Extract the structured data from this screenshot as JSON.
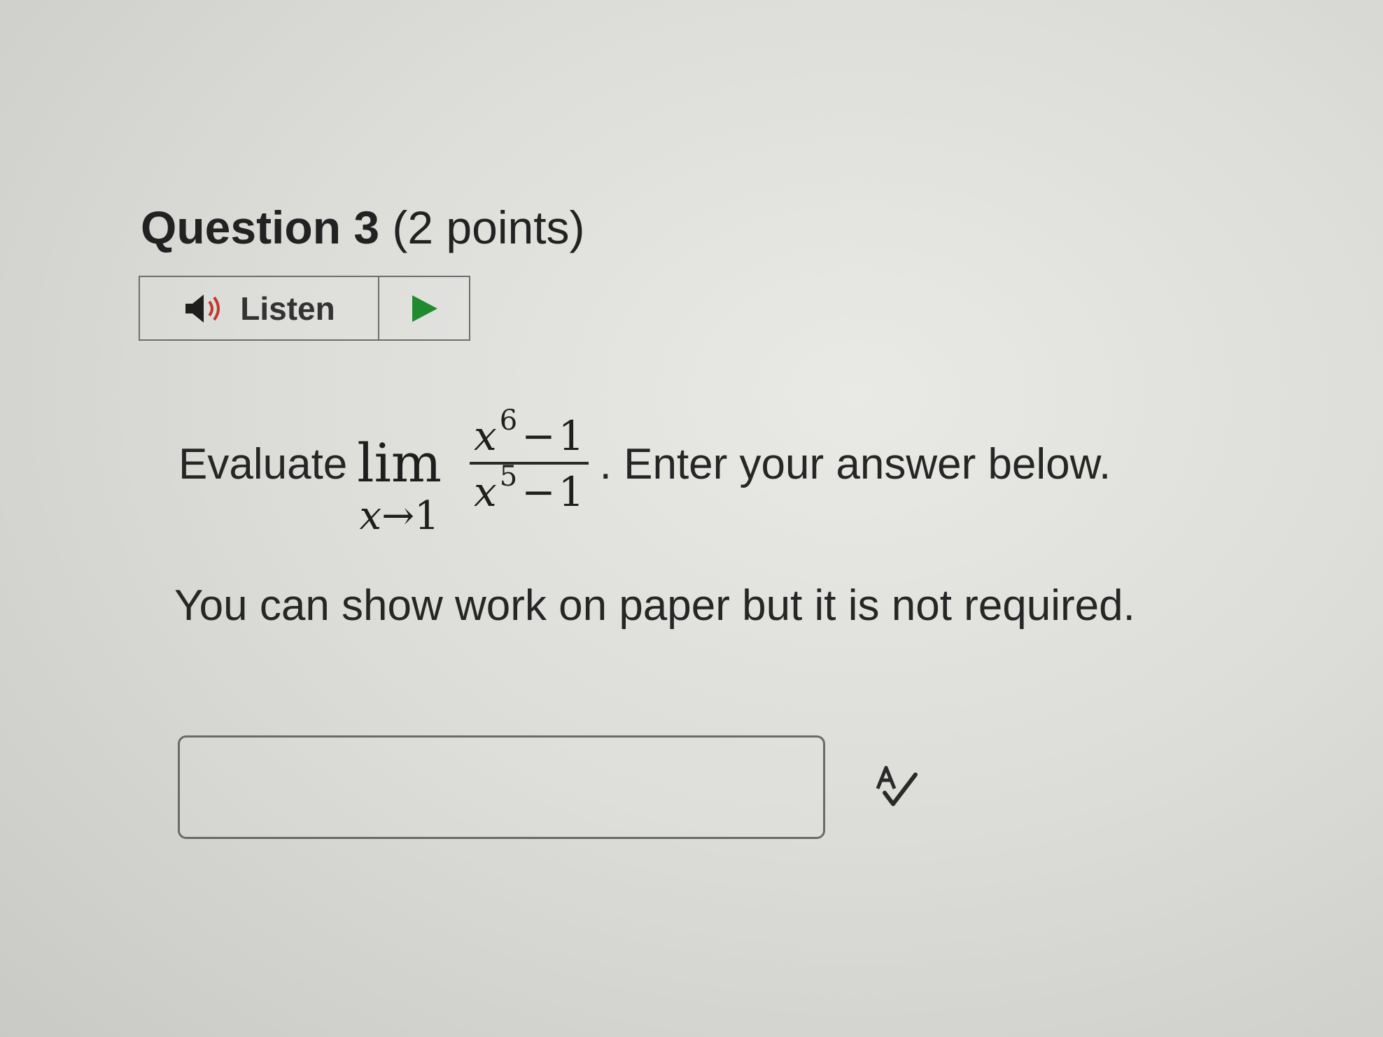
{
  "question": {
    "title": "Question 3",
    "points": "(2 points)"
  },
  "listen": {
    "label": "Listen",
    "speaker_icon": "speaker-icon",
    "play_icon": "play-icon",
    "play_color": "#1f8a2e",
    "speaker_wave_color": "#c0392b"
  },
  "prompt": {
    "lead": "Evaluate",
    "math": {
      "lim": "lim",
      "sub_var": "x",
      "sub_arrow": "→",
      "sub_value": "1",
      "num_var": "x",
      "num_exp": "6",
      "num_op": "−",
      "num_const": "1",
      "den_var": "x",
      "den_exp": "5",
      "den_op": "−",
      "den_const": "1"
    },
    "trail": ". Enter your answer below."
  },
  "note": "You can show work on paper but it is not required.",
  "answer": {
    "value": "",
    "placeholder": ""
  },
  "spellcheck_icon": "spellcheck-icon"
}
